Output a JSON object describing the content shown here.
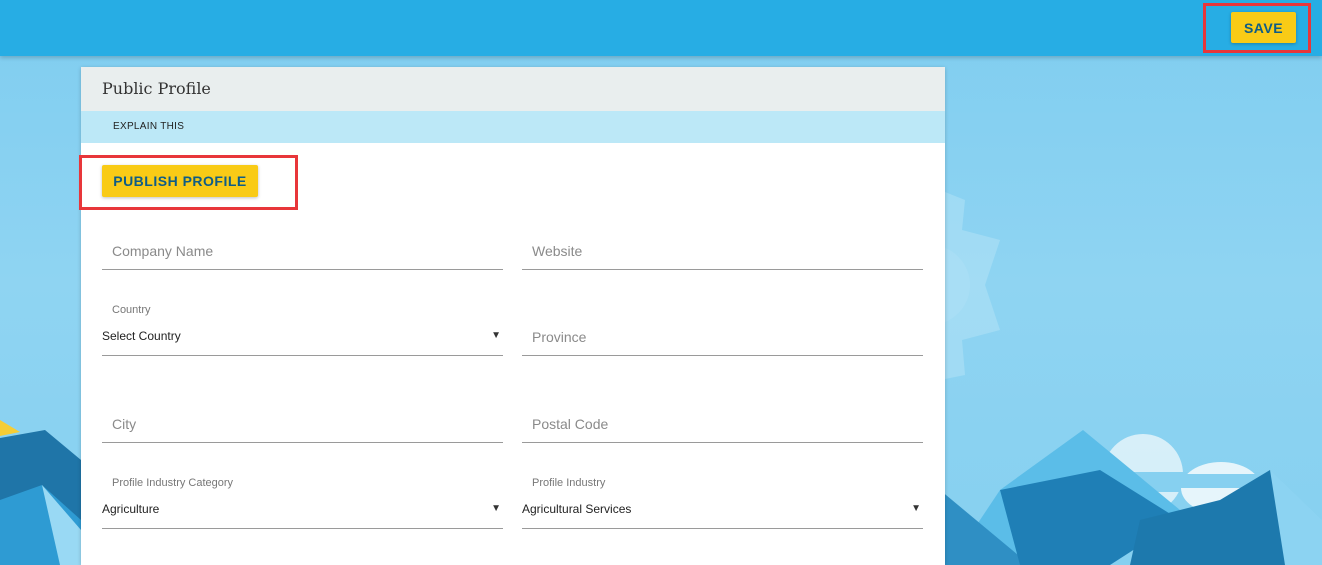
{
  "toolbar": {
    "save_label": "SAVE"
  },
  "card": {
    "title": "Public Profile",
    "explain_label": "EXPLAIN THIS",
    "publish_label": "PUBLISH PROFILE"
  },
  "form": {
    "company_name": {
      "placeholder": "Company Name",
      "value": ""
    },
    "website": {
      "placeholder": "Website",
      "value": ""
    },
    "country": {
      "label": "Country",
      "selected": "Select Country"
    },
    "province": {
      "placeholder": "Province",
      "value": ""
    },
    "city": {
      "placeholder": "City",
      "value": ""
    },
    "postal_code": {
      "placeholder": "Postal Code",
      "value": ""
    },
    "industry_category": {
      "label": "Profile Industry Category",
      "selected": "Agriculture"
    },
    "industry": {
      "label": "Profile Industry",
      "selected": "Agricultural Services"
    }
  },
  "icons": {
    "dropdown": "chevron-down-icon"
  },
  "colors": {
    "topbar": "#27ade4",
    "accent_button": "#f9cb16",
    "button_text": "#0f5d86",
    "highlight_box": "#e8363a",
    "explain_bar": "#bce8f7",
    "card_header": "#e9eeee"
  }
}
